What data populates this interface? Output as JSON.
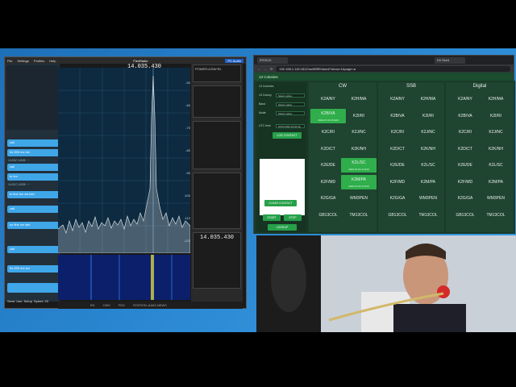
{
  "sdr": {
    "menu": [
      "File",
      "Settings",
      "Profiles",
      "Help"
    ],
    "brand": "FlexRadio",
    "pc_audio": "PC Audio",
    "freq_main": "14.035.430",
    "freq_small": "14.035.430",
    "freq_slice": "14.035.430",
    "station": "STATION: AA0Z-NEW0",
    "version": "v3.1.12",
    "left_buttons": [
      "+TNF",
      "Band",
      "ANT",
      "Display",
      "DAX",
      "CAT"
    ],
    "panel_labels": [
      "POWER:420W.RL",
      "RX",
      "TX"
    ],
    "db_scale": [
      "-50",
      "-60",
      "-70",
      "-80",
      "-90",
      "-100",
      "-110",
      "-120"
    ],
    "freq_ticks": [
      "14.035.0",
      "14.035.2",
      "14.035.4",
      "14.035.6",
      "14.035.8",
      "14.036.0"
    ],
    "log_items": [
      "call",
      "5s 599 ms tnx",
      "call",
      "tu tnx",
      "tx fine tnx cw info",
      "call",
      "so fine cw info",
      "call",
      "5s 599 ms tnx"
    ],
    "bottom_bar": [
      "Send",
      "Use",
      "Setup",
      "Speed",
      "20"
    ],
    "status": [
      "RX",
      "CWX",
      "FDX"
    ]
  },
  "web": {
    "tab1": "IRSS/UI",
    "tab2": "K6 Sked",
    "address": "192.168.1.116:1812/cwWIRE/sked/?show=1&page=a",
    "app_title": "13 Colonies",
    "controls": {
      "header": "13 Colonies",
      "labels": [
        "13 Colony",
        "Band",
        "Mode"
      ],
      "selects": [
        "Select option",
        "Select option",
        "Select option"
      ],
      "time_label": "UTC time",
      "time_value": "07/04 2024 15:04:30",
      "btn_log": "LOG CONTACT",
      "btn_clear": "CLEAR CONTACT",
      "btn_start": "START",
      "btn_stop": "STOP",
      "btn_lookup": "LOOKUP"
    },
    "columns": [
      "CW",
      "SSB",
      "Digital"
    ],
    "cw": [
      {
        "call": "K2A/NY",
        "sub": ""
      },
      {
        "call": "K2H/MA",
        "sub": ""
      },
      {
        "call": "K2B/VA",
        "sub": "2024-07-04 15:02Z"
      },
      {
        "call": "K2I/RI",
        "sub": ""
      },
      {
        "call": "K2C/RI",
        "sub": ""
      },
      {
        "call": "K2J/NC",
        "sub": ""
      },
      {
        "call": "K2D/CT",
        "sub": ""
      },
      {
        "call": "K2K/NH",
        "sub": ""
      },
      {
        "call": "K2E/DE",
        "sub": ""
      },
      {
        "call": "K2L/SC",
        "sub": "2024-07-04 14:51Z"
      },
      {
        "call": "K2F/MD",
        "sub": ""
      },
      {
        "call": "K2M/PA",
        "sub": "2024-07-04 14:47Z"
      },
      {
        "call": "K2G/GA",
        "sub": ""
      },
      {
        "call": "WM3PEN",
        "sub": ""
      },
      {
        "call": "GB13COL",
        "sub": ""
      },
      {
        "call": "TM13COL",
        "sub": ""
      }
    ],
    "ssb": [
      "K2A/NY",
      "K2H/MA",
      "K2B/VA",
      "K2I/RI",
      "K2C/RI",
      "K2J/NC",
      "K2D/CT",
      "K2K/NH",
      "K2E/DE",
      "K2L/SC",
      "K2F/MD",
      "K2M/PA",
      "K2G/GA",
      "WM3PEN",
      "GB13COL",
      "TM13COL"
    ],
    "digital": [
      "K2A/NY",
      "K2H/MA",
      "K2B/VA",
      "K2I/RI",
      "K2C/RI",
      "K2J/NC",
      "K2D/CT",
      "K2K/NH",
      "K2E/DE",
      "K2L/SC",
      "K2F/MD",
      "K2M/PA",
      "K2G/GA",
      "WM3PEN",
      "GB13COL",
      "TM13COL"
    ]
  },
  "colors": {
    "accent": "#2fae4b",
    "sdr_blue": "#3fa6e8"
  }
}
